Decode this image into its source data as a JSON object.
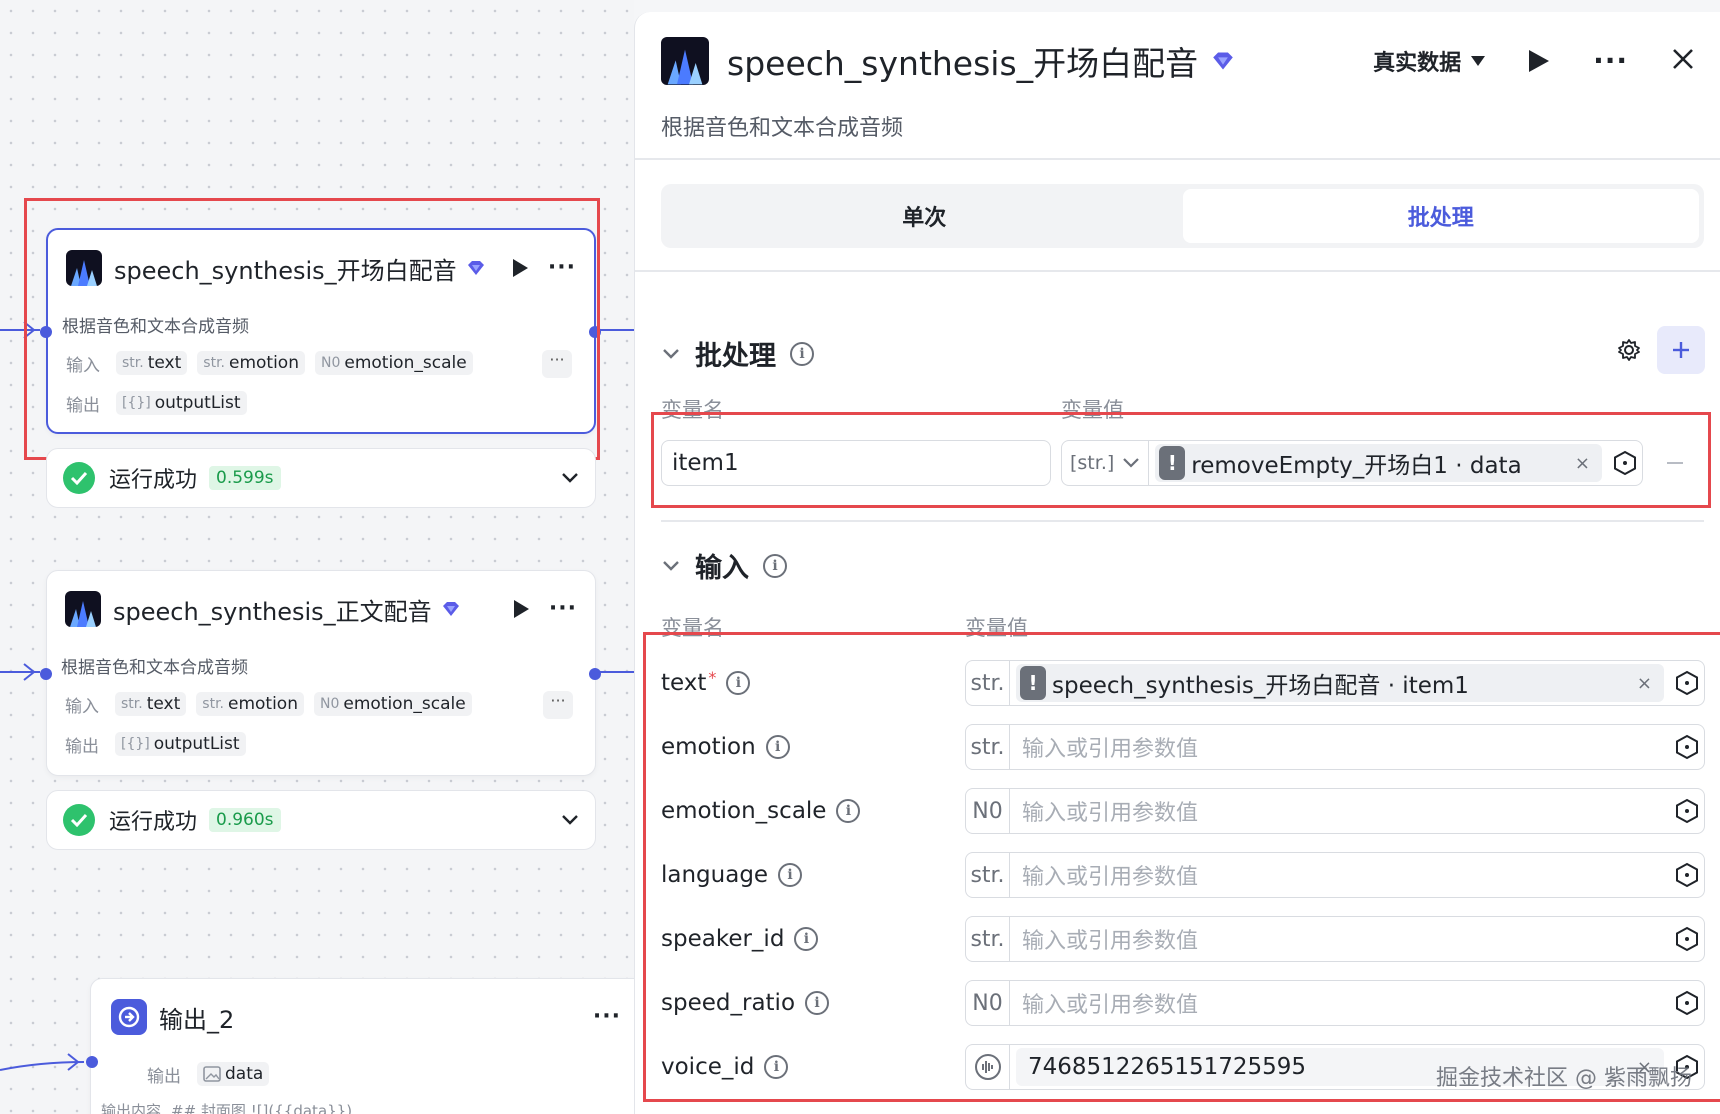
{
  "canvas": {
    "node1": {
      "title": "speech_synthesis_开场白配音",
      "desc": "根据音色和文本合成音频",
      "input_label": "输入",
      "inputs": [
        {
          "type": "str.",
          "name": "text"
        },
        {
          "type": "str.",
          "name": "emotion"
        },
        {
          "type": "N0",
          "name": "emotion_scale"
        }
      ],
      "output_label": "输出",
      "outputs": [
        {
          "type": "[{}]",
          "name": "outputList"
        }
      ],
      "more": "···"
    },
    "status1": {
      "text": "运行成功",
      "time": "0.599s"
    },
    "node2": {
      "title": "speech_synthesis_正文配音",
      "desc": "根据音色和文本合成音频",
      "input_label": "输入",
      "inputs": [
        {
          "type": "str.",
          "name": "text"
        },
        {
          "type": "str.",
          "name": "emotion"
        },
        {
          "type": "N0",
          "name": "emotion_scale"
        }
      ],
      "output_label": "输出",
      "outputs": [
        {
          "type": "[{}]",
          "name": "outputList"
        }
      ],
      "more": "···"
    },
    "status2": {
      "text": "运行成功",
      "time": "0.960s"
    },
    "node3": {
      "title": "输出_2",
      "output_label": "输出",
      "output_name": "data",
      "content_label": "输出内容",
      "content_preview": "## 封面图 ![]({{data}})"
    }
  },
  "panel": {
    "title": "speech_synthesis_开场白配音",
    "desc": "根据音色和文本合成音频",
    "data_mode": "真实数据",
    "tabs": [
      "单次",
      "批处理"
    ],
    "active_tab": "批处理",
    "batch": {
      "title": "批处理",
      "col_name": "变量名",
      "col_value": "变量值",
      "item_name": "item1",
      "item_type": "[str.]",
      "item_ref": "removeEmpty_开场白1 · data"
    },
    "input": {
      "title": "输入",
      "col_name": "变量名",
      "col_value": "变量值",
      "rows": [
        {
          "name": "text",
          "required": "*",
          "type": "str.",
          "ref": "speech_synthesis_开场白配音 · item1"
        },
        {
          "name": "emotion",
          "type": "str.",
          "placeholder": "输入或引用参数值"
        },
        {
          "name": "emotion_scale",
          "type": "N0",
          "placeholder": "输入或引用参数值"
        },
        {
          "name": "language",
          "type": "str.",
          "placeholder": "输入或引用参数值"
        },
        {
          "name": "speaker_id",
          "type": "str.",
          "placeholder": "输入或引用参数值"
        },
        {
          "name": "speed_ratio",
          "type": "N0",
          "placeholder": "输入或引用参数值"
        },
        {
          "name": "voice_id",
          "type": "voice",
          "value": "7468512265151725595"
        }
      ]
    }
  },
  "watermark": "掘金技术社区 @ 紫雨飘扬",
  "colors": {
    "accent": "#4b5bdc",
    "success": "#2ec26d",
    "highlight": "#e5484d"
  }
}
